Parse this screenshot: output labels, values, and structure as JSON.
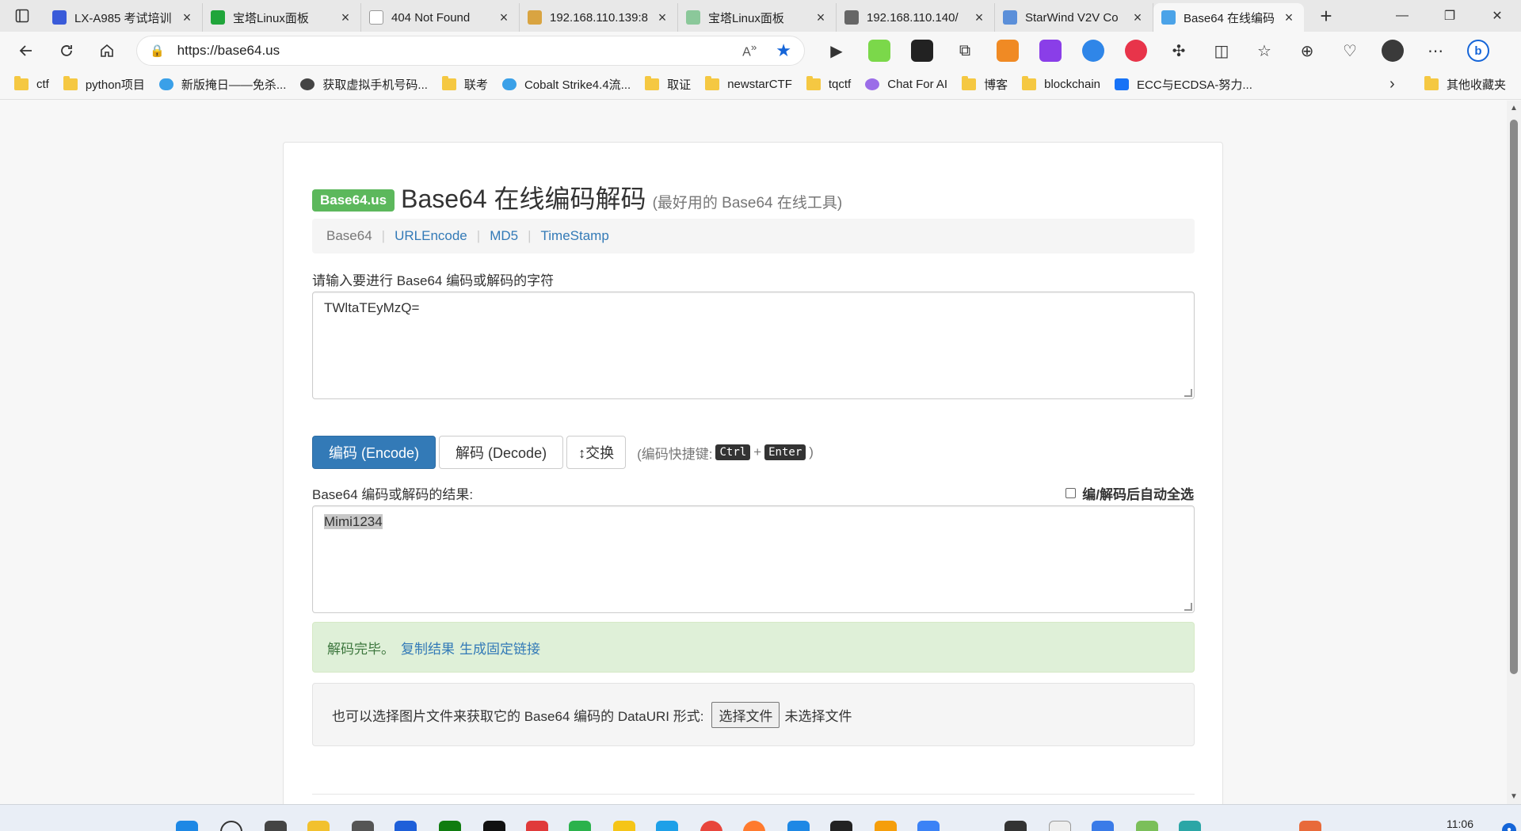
{
  "browser": {
    "tabs": [
      {
        "title": "LX-A985 考试培训",
        "icon_color": "#3a5bd9"
      },
      {
        "title": "宝塔Linux面板",
        "icon_color": "#20a53a"
      },
      {
        "title": "404 Not Found",
        "icon_color": "#bbbbbb"
      },
      {
        "title": "192.168.110.139:8",
        "icon_color": "#d9a441"
      },
      {
        "title": "宝塔Linux面板",
        "icon_color": "#8bc89a"
      },
      {
        "title": "192.168.110.140/",
        "icon_color": "#666666"
      },
      {
        "title": "StarWind V2V Co",
        "icon_color": "#5b8fd9"
      },
      {
        "title": "Base64 在线编码",
        "icon_color": "#4ba3e8"
      }
    ],
    "url": "https://base64.us",
    "bookmarks": [
      {
        "label": "ctf",
        "kind": "folder"
      },
      {
        "label": "python项目",
        "kind": "folder"
      },
      {
        "label": "新版掩日——免杀...",
        "kind": "cloud"
      },
      {
        "label": "获取虚拟手机号码...",
        "kind": "dot"
      },
      {
        "label": "联考",
        "kind": "folder"
      },
      {
        "label": "Cobalt Strike4.4流...",
        "kind": "cloud"
      },
      {
        "label": "取证",
        "kind": "folder"
      },
      {
        "label": "newstarCTF",
        "kind": "folder"
      },
      {
        "label": "tqctf",
        "kind": "folder"
      },
      {
        "label": "Chat For AI",
        "kind": "dot"
      },
      {
        "label": "博客",
        "kind": "folder"
      },
      {
        "label": "blockchain",
        "kind": "folder"
      },
      {
        "label": "ECC与ECDSA-努力...",
        "kind": "zhihu"
      }
    ],
    "other_bookmarks": "其他收藏夹",
    "clock": "11:06"
  },
  "page": {
    "brand": "Base64.us",
    "title": "Base64 在线编码解码",
    "subtitle": "(最好用的 Base64 在线工具)",
    "nav": [
      "Base64",
      "URLEncode",
      "MD5",
      "TimeStamp"
    ],
    "input_label": "请输入要进行 Base64 编码或解码的字符",
    "input_value": "TWltaTEyMzQ=",
    "encode_button": "编码 (Encode)",
    "decode_button": "解码 (Decode)",
    "swap_button": "↕交换",
    "shortcut_hint_open": "(编码快捷键:",
    "shortcut_key1": "Ctrl",
    "shortcut_plus": "+",
    "shortcut_key2": "Enter",
    "shortcut_hint_close": ")",
    "result_label": "Base64 编码或解码的结果:",
    "auto_select_label": "编/解码后自动全选",
    "result_value": "Mimi1234",
    "status_message": "解码完毕。",
    "copy_link": "复制结果",
    "permalink": "生成固定链接",
    "file_prompt": "也可以选择图片文件来获取它的 Base64 编码的 DataURI 形式:",
    "file_button": "选择文件",
    "file_status": "未选择文件"
  }
}
